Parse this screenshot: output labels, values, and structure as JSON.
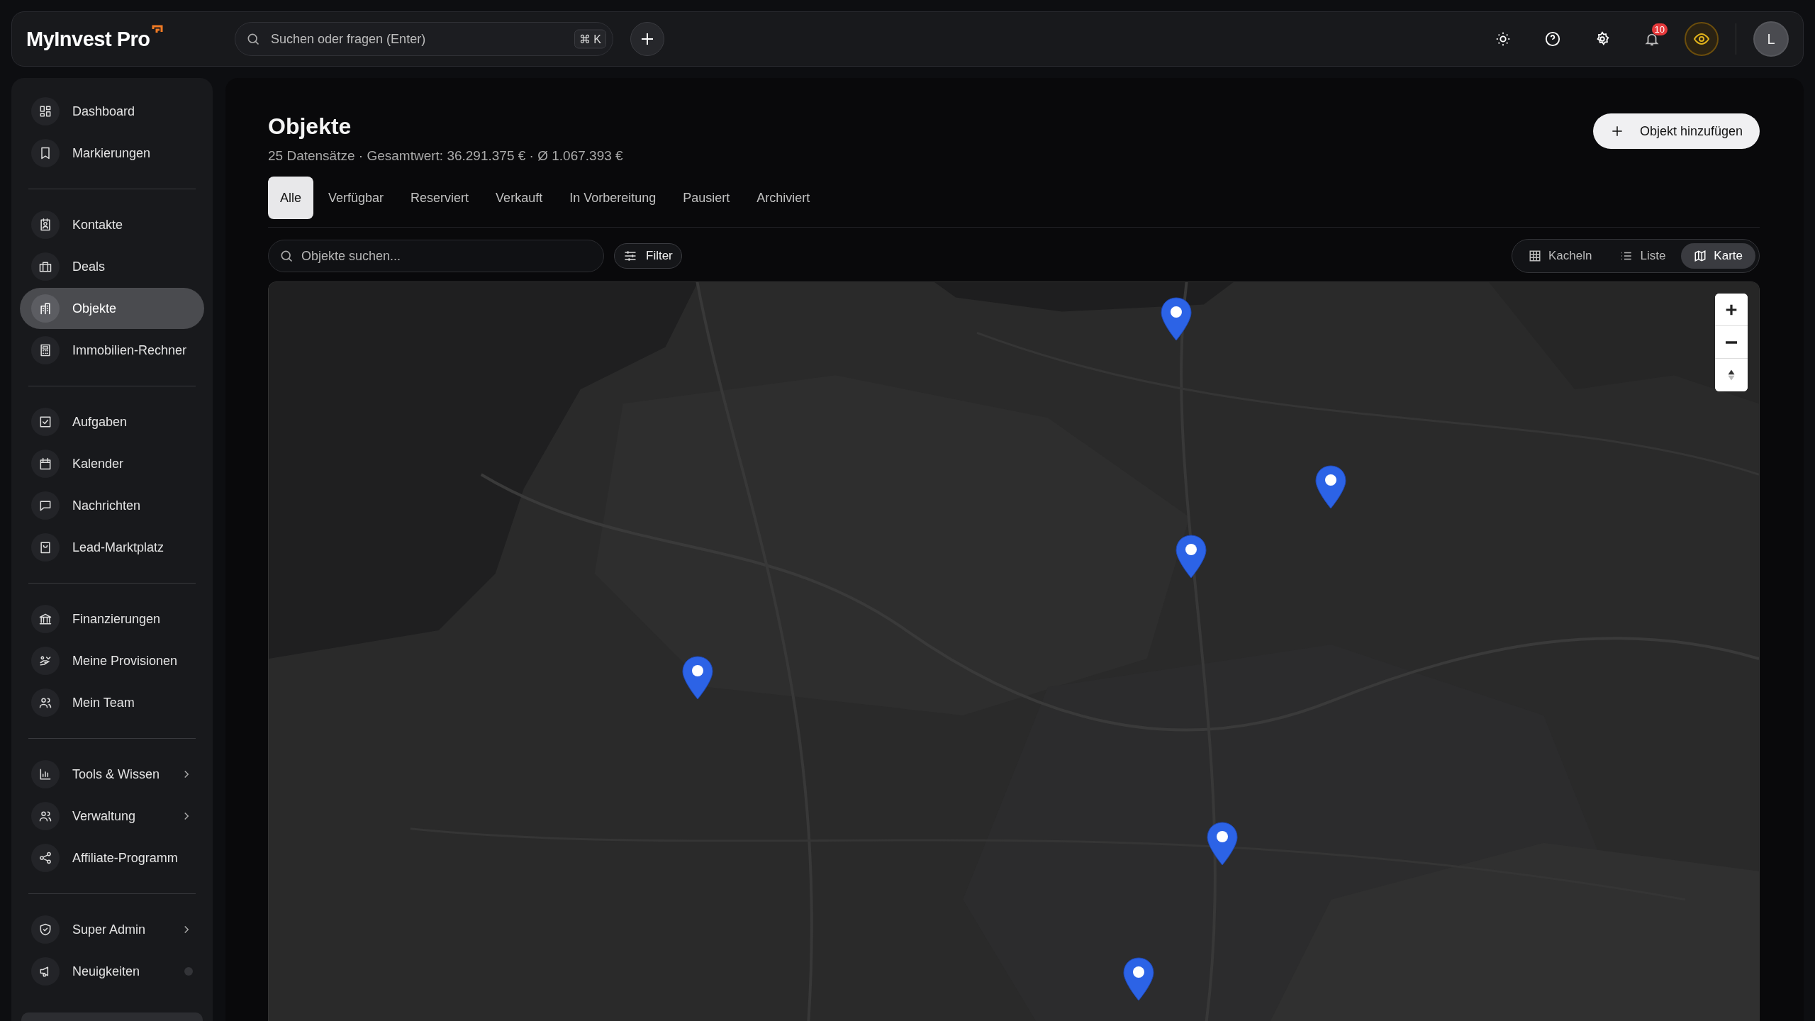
{
  "topbar": {
    "logo": "MyInvest Pro",
    "search": {
      "placeholder": "Suchen oder fragen (Enter)",
      "shortcut": "⌘ K"
    },
    "notifications_badge": "10",
    "avatar": "L"
  },
  "sidebar": {
    "groups": [
      [
        {
          "label": "Dashboard",
          "kind": "link",
          "selected": false
        },
        {
          "label": "Markierungen",
          "kind": "link",
          "selected": false
        }
      ],
      [
        {
          "label": "Kontakte",
          "kind": "link",
          "selected": false
        },
        {
          "label": "Deals",
          "kind": "link",
          "selected": false
        },
        {
          "label": "Objekte",
          "kind": "link",
          "selected": true
        },
        {
          "label": "Immobilien-Rechner",
          "kind": "link",
          "selected": false
        }
      ],
      [
        {
          "label": "Aufgaben",
          "kind": "link",
          "selected": false
        },
        {
          "label": "Kalender",
          "kind": "link",
          "selected": false
        },
        {
          "label": "Nachrichten",
          "kind": "link",
          "selected": false
        },
        {
          "label": "Lead-Marktplatz",
          "kind": "link",
          "selected": false
        }
      ],
      [
        {
          "label": "Finanzierungen",
          "kind": "link",
          "selected": false
        },
        {
          "label": "Meine Provisionen",
          "kind": "link",
          "selected": false
        },
        {
          "label": "Mein Team",
          "kind": "link",
          "selected": false
        }
      ],
      [
        {
          "label": "Tools & Wissen",
          "kind": "submenu",
          "selected": false
        },
        {
          "label": "Verwaltung",
          "kind": "submenu",
          "selected": false
        },
        {
          "label": "Affiliate-Programm",
          "kind": "link",
          "selected": false
        }
      ],
      [
        {
          "label": "Super Admin",
          "kind": "submenu",
          "selected": false
        },
        {
          "label": "Neuigkeiten",
          "kind": "indicator",
          "selected": false
        }
      ]
    ]
  },
  "page": {
    "title": "Objekte",
    "summary": "25 Datensätze · Gesamtwert: 36.291.375 € · Ø 1.067.393 €",
    "add_button": "Objekt hinzufügen",
    "tabs": [
      {
        "label": "Alle",
        "selected": true
      },
      {
        "label": "Verfügbar",
        "selected": false
      },
      {
        "label": "Reserviert",
        "selected": false
      },
      {
        "label": "Verkauft",
        "selected": false
      },
      {
        "label": "In Vorbereitung",
        "selected": false
      },
      {
        "label": "Pausiert",
        "selected": false
      },
      {
        "label": "Archiviert",
        "selected": false
      }
    ],
    "search": {
      "placeholder": "Objekte suchen..."
    },
    "filter_button": "Filter",
    "views": [
      {
        "label": "Kacheln",
        "selected": false
      },
      {
        "label": "Liste",
        "selected": false
      },
      {
        "label": "Karte",
        "selected": true
      }
    ]
  }
}
